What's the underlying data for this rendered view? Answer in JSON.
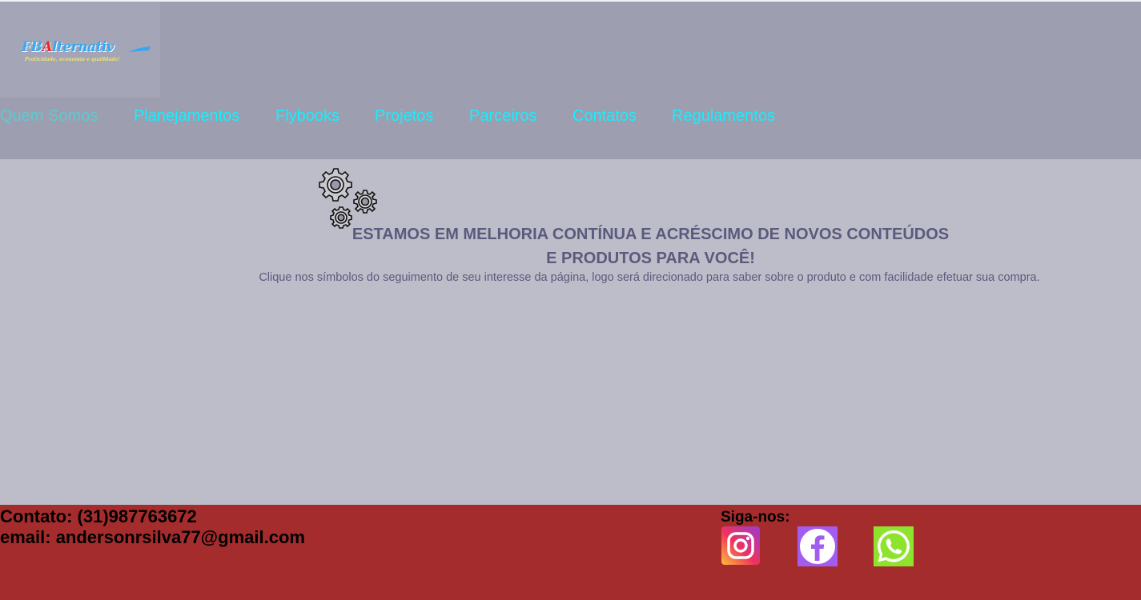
{
  "header": {
    "logo": {
      "text_fb": "FB",
      "text_a": "A",
      "text_rest": "lternativ",
      "tagline": "Praticidade, economia e qualidade!"
    },
    "nav": [
      {
        "label": "Quem Somos",
        "active": true
      },
      {
        "label": "Planejamentos",
        "active": false
      },
      {
        "label": "Flybooks",
        "active": false
      },
      {
        "label": "Projetos",
        "active": false
      },
      {
        "label": "Parceiros",
        "active": false
      },
      {
        "label": "Contatos",
        "active": false
      },
      {
        "label": "Regulamentos",
        "active": false
      }
    ]
  },
  "main": {
    "icon": "gears-icon",
    "headline_line1": "ESTAMOS EM MELHORIA CONTÍNUA E ACRÉSCIMO DE NOVOS CONTEÚDOS",
    "headline_line2": "E PRODUTOS PARA VOCÊ!",
    "subtext": "Clique nos símbolos do seguimento de seu interesse da página, logo será direcionado para saber sobre o produto e com facilidade efetuar sua compra."
  },
  "footer": {
    "contact": "Contato: (31)987763672",
    "email": "email: andersonrsilva77@gmail.com",
    "follow_label": "Siga-nos:",
    "social": [
      {
        "name": "instagram-icon"
      },
      {
        "name": "facebook-icon"
      },
      {
        "name": "whatsapp-icon"
      }
    ]
  },
  "colors": {
    "header_bg": "#9d9eb0",
    "main_bg": "#bdbdc9",
    "footer_bg": "#a52c2c",
    "nav_link": "#14f0ff",
    "nav_active": "#5fc9cf",
    "headline": "#5a5a7c"
  }
}
